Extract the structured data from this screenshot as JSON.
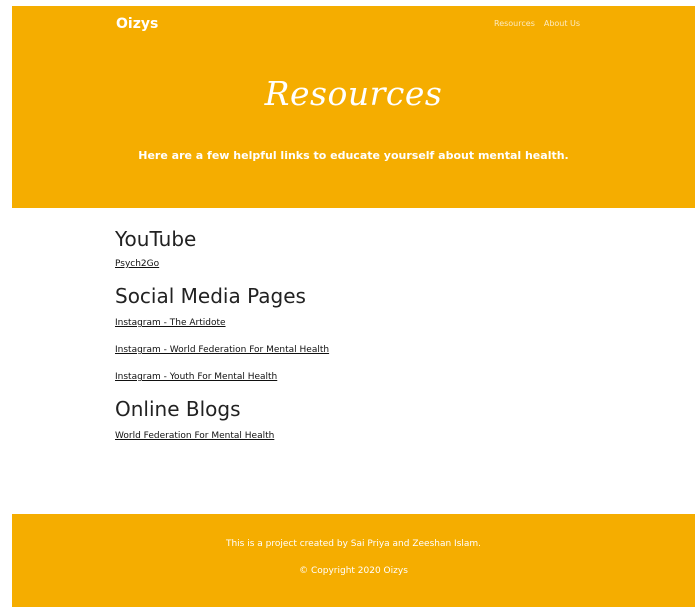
{
  "navbar": {
    "brand": "Oizys",
    "links": [
      {
        "label": "Resources"
      },
      {
        "label": "About Us"
      }
    ]
  },
  "hero": {
    "title": "Resources",
    "subtitle": "Here are a few helpful links to educate yourself about mental health."
  },
  "sections": [
    {
      "heading": "YouTube",
      "links": [
        {
          "label": "Psych2Go"
        }
      ]
    },
    {
      "heading": "Social Media Pages",
      "links": [
        {
          "label": "Instagram - The Artidote"
        },
        {
          "label": "Instagram - World Federation For Mental Health"
        },
        {
          "label": "Instagram - Youth For Mental Health"
        }
      ]
    },
    {
      "heading": "Online Blogs",
      "links": [
        {
          "label": "World Federation For Mental Health"
        }
      ]
    }
  ],
  "footer": {
    "credit": "This is a project created by Sai Priya and Zeeshan Islam.",
    "copyright": "© Copyright 2020 Oizys"
  },
  "colors": {
    "accent": "#f5ad00",
    "text_on_accent": "#ffffff",
    "body_text": "#222222"
  }
}
